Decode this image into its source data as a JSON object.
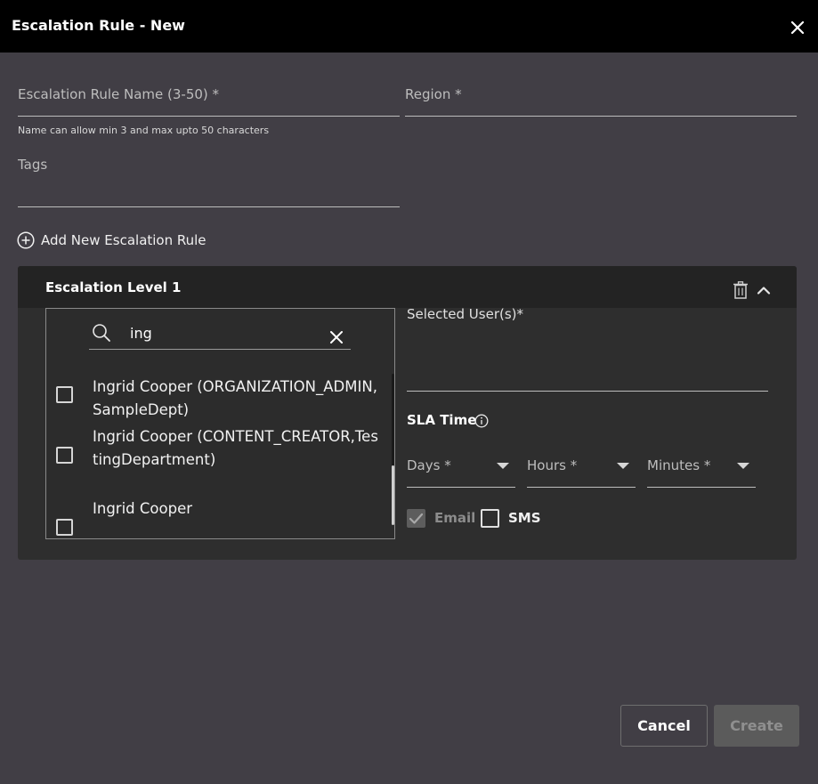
{
  "header": {
    "title": "Escalation Rule - New"
  },
  "form": {
    "name_label": "Escalation Rule Name (3-50) *",
    "name_helper": "Name can allow min 3 and max upto 50 characters",
    "region_label": "Region *",
    "tags_label": "Tags",
    "add_rule_label": "Add New Escalation Rule"
  },
  "level": {
    "title": "Escalation Level 1",
    "search": {
      "value": "ing"
    },
    "options": [
      {
        "label": "Ingrid Cooper (ORGANIZATION_ADMIN,SampleDept)"
      },
      {
        "label": "Ingrid Cooper (CONTENT_CREATOR,TestingDepartment)"
      },
      {
        "label": "Ingrid Cooper"
      }
    ],
    "selected_users_label": "Selected User(s)*",
    "sla": {
      "label": "SLA Time",
      "days_label": "Days *",
      "hours_label": "Hours *",
      "minutes_label": "Minutes *"
    },
    "notify": {
      "email_label": "Email",
      "sms_label": "SMS"
    }
  },
  "actions": {
    "cancel_label": "Cancel",
    "create_label": "Create"
  },
  "icons": [
    "close-icon",
    "add-circle-icon",
    "trash-icon",
    "chevron-up-icon",
    "search-icon",
    "clear-icon",
    "info-icon",
    "checkmark-icon",
    "caret-down-icon"
  ]
}
